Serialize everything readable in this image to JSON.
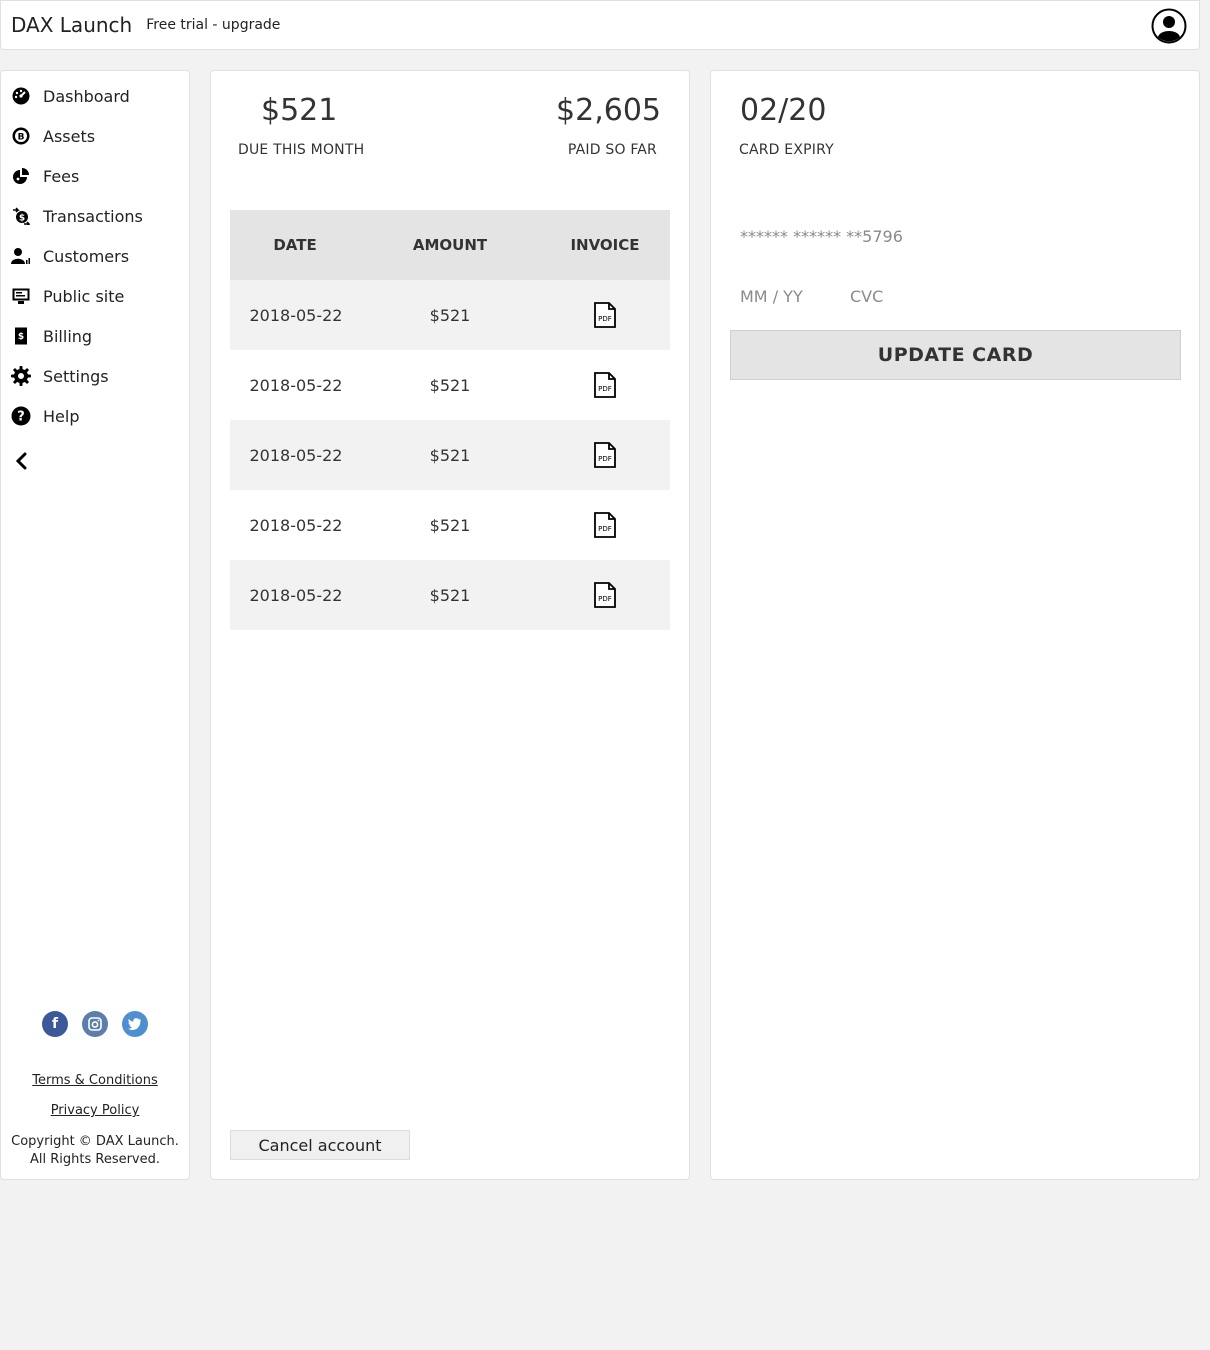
{
  "header": {
    "brand": "DAX Launch",
    "trial_text": "Free trial - upgrade"
  },
  "sidebar": {
    "items": [
      {
        "label": "Dashboard",
        "icon": "dashboard-icon"
      },
      {
        "label": "Assets",
        "icon": "bitcoin-icon"
      },
      {
        "label": "Fees",
        "icon": "pie-chart-icon"
      },
      {
        "label": "Transactions",
        "icon": "transactions-icon"
      },
      {
        "label": "Customers",
        "icon": "customers-icon"
      },
      {
        "label": "Public site",
        "icon": "monitor-icon"
      },
      {
        "label": "Billing",
        "icon": "billing-icon"
      },
      {
        "label": "Settings",
        "icon": "gear-icon"
      },
      {
        "label": "Help",
        "icon": "help-icon"
      }
    ],
    "footer": {
      "terms": "Terms & Conditions",
      "privacy": "Privacy Policy",
      "copyright_line1": "Copyright © DAX Launch.",
      "copyright_line2": "All Rights Reserved."
    }
  },
  "billing": {
    "due_amount": "$521",
    "due_label": "DUE THIS MONTH",
    "paid_amount": "$2,605",
    "paid_label": "PAID SO FAR",
    "table": {
      "headers": [
        "DATE",
        "AMOUNT",
        "INVOICE"
      ],
      "rows": [
        {
          "date": "2018-05-22",
          "amount": "$521"
        },
        {
          "date": "2018-05-22",
          "amount": "$521"
        },
        {
          "date": "2018-05-22",
          "amount": "$521"
        },
        {
          "date": "2018-05-22",
          "amount": "$521"
        },
        {
          "date": "2018-05-22",
          "amount": "$521"
        }
      ]
    },
    "cancel_label": "Cancel account"
  },
  "card": {
    "expiry": "02/20",
    "expiry_label": "CARD EXPIRY",
    "number_masked": "****** ****** **5796",
    "exp_placeholder": "MM / YY",
    "cvc_placeholder": "CVC",
    "update_label": "UPDATE CARD"
  },
  "colors": {
    "facebook": "#3b5998",
    "instagram": "#5b7fa8",
    "twitter": "#4e8fcf"
  }
}
